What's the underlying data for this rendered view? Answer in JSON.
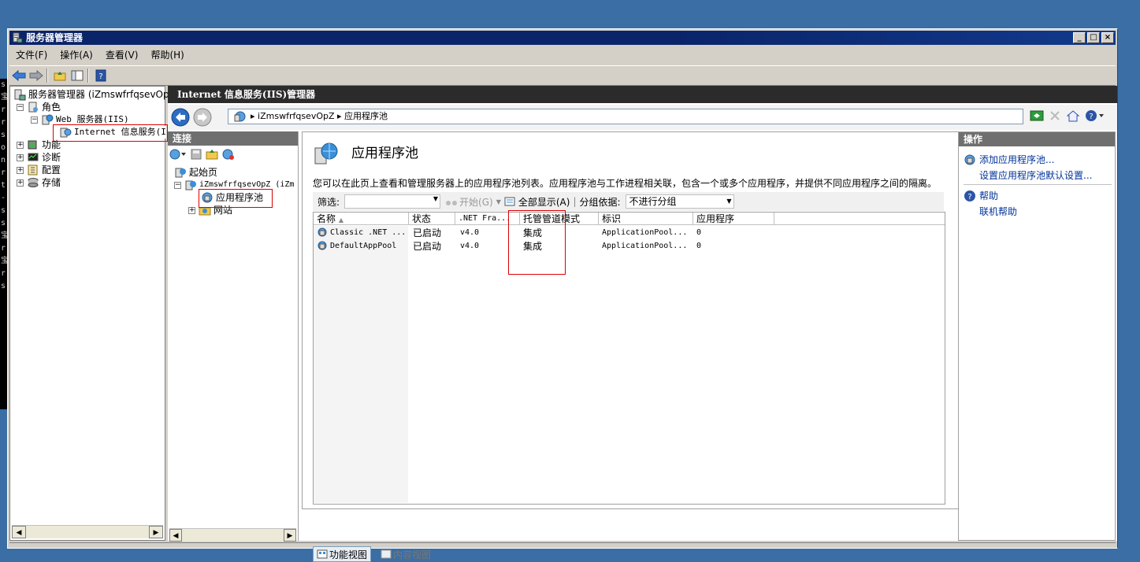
{
  "window": {
    "title": "服务器管理器",
    "min": "_",
    "max": "□",
    "close": "×"
  },
  "menu": [
    "文件(F)",
    "操作(A)",
    "查看(V)",
    "帮助(H)"
  ],
  "left_tree": {
    "root": "服务器管理器 (iZmswfrfqsevOp",
    "roles": "角色",
    "web_server": "Web 服务器(IIS)",
    "iis": "Internet 信息服务(I",
    "features": "功能",
    "diagnostics": "诊断",
    "config": "配置",
    "storage": "存储"
  },
  "iis": {
    "header": "Internet 信息服务(IIS)管理器",
    "breadcrumb_server": "iZmswfrfqsevOpZ",
    "breadcrumb_page": "应用程序池"
  },
  "connections": {
    "title": "连接",
    "start": "起始页",
    "server": "iZmswfrfqsevOpZ (iZm",
    "app_pools": "应用程序池",
    "sites": "网站"
  },
  "center": {
    "title": "应用程序池",
    "description": "您可以在此页上查看和管理服务器上的应用程序池列表。应用程序池与工作进程相关联，包含一个或多个应用程序，并提供不同应用程序之间的隔离。",
    "filter_label": "筛选:",
    "start_btn": "开始(G)",
    "show_all": "全部显示(A)",
    "group_label": "分组依据:",
    "group_value": "不进行分组",
    "columns": [
      "名称",
      "状态",
      ".NET Fra...",
      "托管管道模式",
      "标识",
      "应用程序"
    ],
    "rows": [
      [
        "Classic .NET ...",
        "已启动",
        "v4.0",
        "集成",
        "ApplicationPool...",
        "0"
      ],
      [
        "DefaultAppPool",
        "已启动",
        "v4.0",
        "集成",
        "ApplicationPool...",
        "0"
      ]
    ],
    "view_features": "功能视图",
    "view_content": "内容视图"
  },
  "actions": {
    "title": "操作",
    "add_pool": "添加应用程序池...",
    "set_defaults": "设置应用程序池默认设置...",
    "help": "帮助",
    "online_help": "联机帮助"
  },
  "left_strip": [
    "s",
    "宝",
    "r",
    "r",
    "s",
    "o",
    "n",
    "r",
    "t",
    "-",
    "s",
    "s",
    "宝",
    "r",
    "宝",
    "r",
    "s"
  ]
}
